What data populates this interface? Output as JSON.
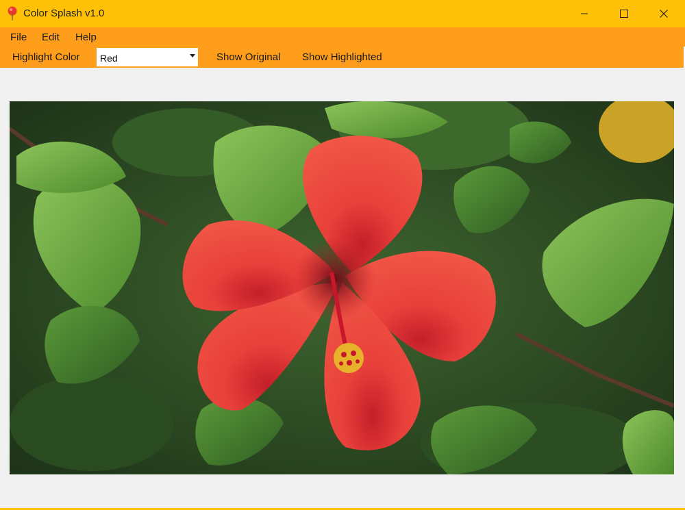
{
  "window": {
    "title": "Color Splash v1.0",
    "titlebar_color": "#ffc107",
    "app_icon": "map-pin-icon",
    "controls": [
      "minimize-icon",
      "maximize-icon",
      "close-icon"
    ]
  },
  "menu": {
    "items": [
      {
        "label": "File"
      },
      {
        "label": "Edit"
      },
      {
        "label": "Help"
      }
    ],
    "bar_color": "#ff9e1b"
  },
  "toolbar": {
    "highlight_label": "Highlight Color",
    "highlight_select": {
      "value": "Red"
    },
    "show_original_label": "Show Original",
    "show_highlighted_label": "Show Highlighted"
  },
  "image": {
    "subject": "red hibiscus flower among green leaves",
    "colors": {
      "flower": "#e8403a",
      "leaves": "#5a9a35",
      "background": "#2e4a22"
    }
  }
}
